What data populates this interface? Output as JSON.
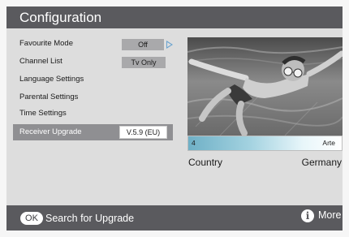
{
  "window": {
    "title": "Configuration"
  },
  "menu": {
    "items": [
      {
        "label": "Favourite Mode",
        "value": "Off"
      },
      {
        "label": "Channel List",
        "value": "Tv Only"
      },
      {
        "label": "Language Settings"
      },
      {
        "label": "Parental Settings"
      },
      {
        "label": "Time Settings"
      },
      {
        "label": "Receiver Upgrade",
        "value": "V.5.9 (EU)",
        "selected": true
      }
    ]
  },
  "preview": {
    "channel_number": "4",
    "channel_name": "Arte",
    "country_label": "Country",
    "country_value": "Germany"
  },
  "footer": {
    "ok_label": "OK",
    "action_text": "Search for Upgrade",
    "more_label": "More"
  },
  "colors": {
    "title_bar": "#5a5a5e",
    "panel": "#dddddd",
    "selection": "#8f8f92",
    "value_box": "#a9a9ab",
    "channel_bar_accent": "#6fb0c6",
    "arrow": "#6aa3cf"
  },
  "icons": [
    "right-arrow-icon",
    "info-icon"
  ]
}
